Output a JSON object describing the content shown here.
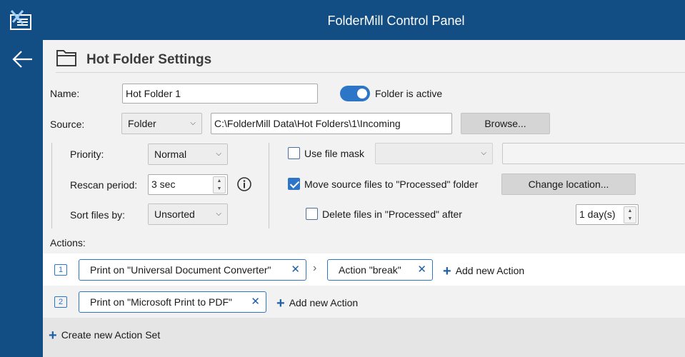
{
  "window": {
    "title": "FolderMill Control Panel"
  },
  "header": {
    "title": "Hot Folder Settings"
  },
  "form": {
    "name_label": "Name:",
    "name_value": "Hot Folder 1",
    "active_label": "Folder is active",
    "active": true,
    "source_label": "Source:",
    "source_type": "Folder",
    "source_path": "C:\\FolderMill Data\\Hot Folders\\1\\Incoming",
    "browse_label": "Browse...",
    "priority_label": "Priority:",
    "priority_value": "Normal",
    "rescan_label": "Rescan period:",
    "rescan_value": "3 sec",
    "sort_label": "Sort files by:",
    "sort_value": "Unsorted",
    "file_mask_label": "Use file mask",
    "file_mask_checked": false,
    "move_label": "Move source files to \"Processed\" folder",
    "move_checked": true,
    "change_location_label": "Change location...",
    "delete_label": "Delete files in \"Processed\" after",
    "delete_checked": false,
    "delete_days": "1 day(s)"
  },
  "actions": {
    "label": "Actions:",
    "sets": [
      {
        "number": "1",
        "items": [
          "Print on \"Universal Document Converter\"",
          "Action \"break\""
        ],
        "add_label": "Add new Action"
      },
      {
        "number": "2",
        "items": [
          "Print on \"Microsoft Print to PDF\""
        ],
        "add_label": "Add new Action"
      }
    ],
    "create_set_label": "Create new Action Set"
  },
  "colors": {
    "titlebar": "#124d84",
    "accent": "#2d76c7"
  },
  "icons": {
    "logo": "foldermill-logo-icon",
    "back": "back-arrow-icon",
    "folder": "folder-icon",
    "info": "info-icon",
    "close": "close-icon",
    "plus": "plus-icon"
  }
}
